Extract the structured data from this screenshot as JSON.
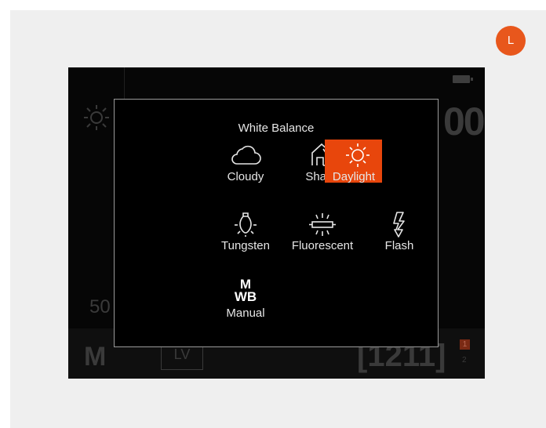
{
  "corner_badge": {
    "letter": "L"
  },
  "camera": {
    "big_value": "00",
    "iso_value": "50",
    "mode": "M",
    "lv_label": "LV",
    "shots_remaining": "[1211]",
    "card_1": "1",
    "card_2": "2"
  },
  "dialog": {
    "title": "White Balance",
    "options": [
      {
        "label": "Cloudy",
        "icon": "cloud-icon",
        "selected": false
      },
      {
        "label": "Shade",
        "icon": "shade-house-icon",
        "selected": false
      },
      {
        "label": "Daylight",
        "icon": "sun-icon",
        "selected": true
      },
      {
        "label": "Tungsten",
        "icon": "bulb-icon",
        "selected": false
      },
      {
        "label": "Fluorescent",
        "icon": "fluorescent-tube-icon",
        "selected": false
      },
      {
        "label": "Flash",
        "icon": "flash-icon",
        "selected": false
      },
      {
        "label": "Manual",
        "icon": "manual-wb-icon",
        "icon_text": [
          "M",
          "WB"
        ],
        "selected": false
      }
    ]
  },
  "colors": {
    "accent": "#e8460c",
    "badge": "#e8571c",
    "screen": "#060606"
  }
}
